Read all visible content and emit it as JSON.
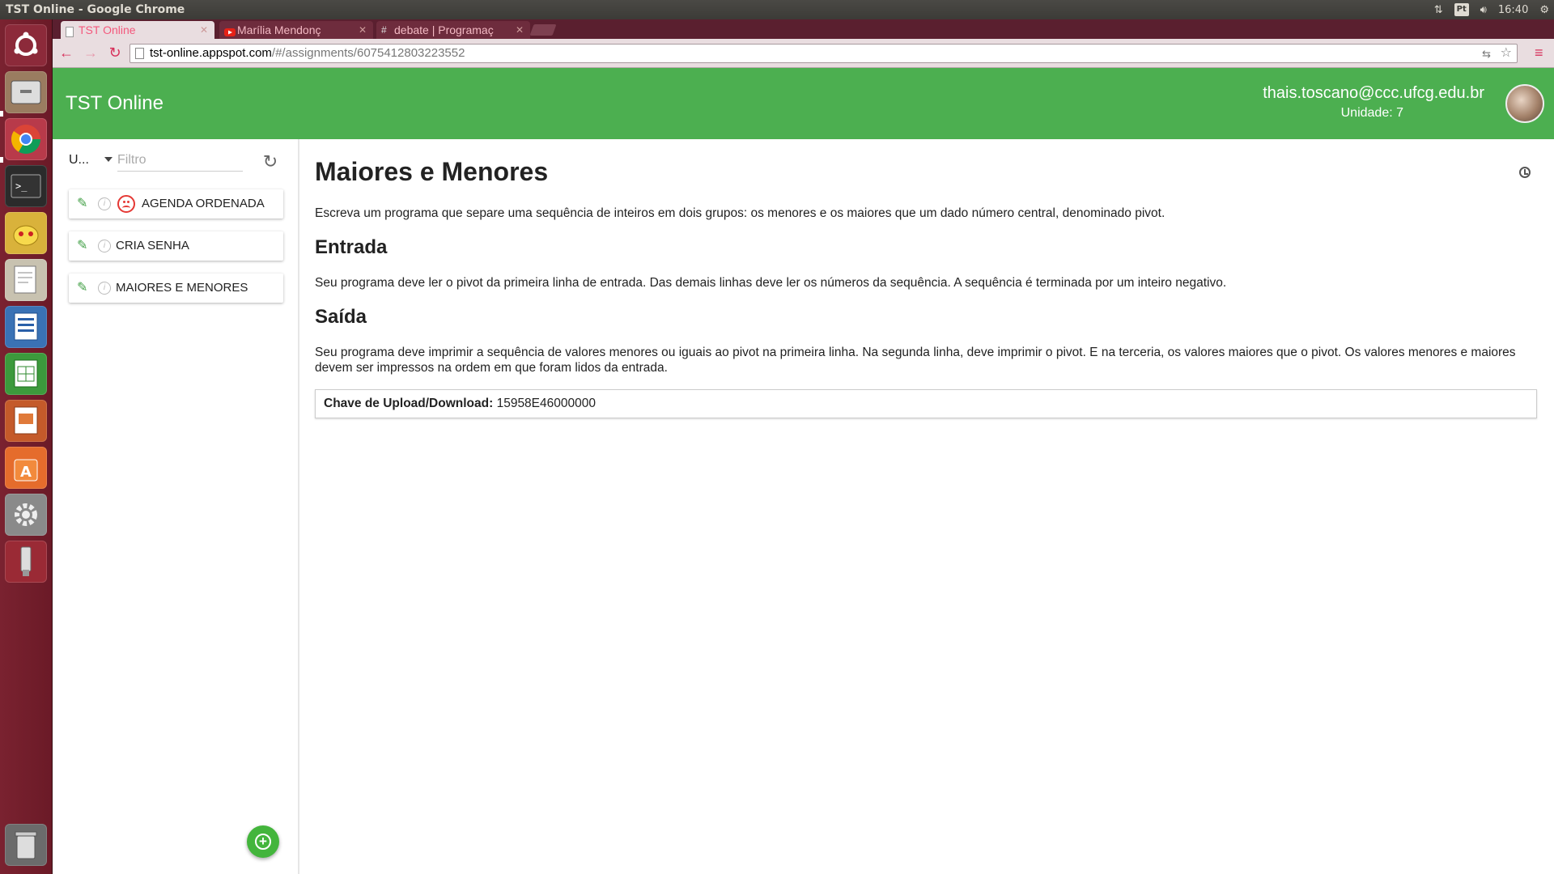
{
  "panel": {
    "window_title": "TST Online - Google Chrome",
    "keyboard_layout": "Pt",
    "clock": "16:40"
  },
  "browser": {
    "tabs": [
      {
        "title": "TST Online",
        "active": true
      },
      {
        "title": "Marília Mendonç",
        "active": false
      },
      {
        "title": "debate | Programaç",
        "active": false
      }
    ],
    "url_host": "tst-online.appspot.com",
    "url_path": "/#/assignments/6075412803223552"
  },
  "header": {
    "title": "TST Online",
    "email": "thais.toscano@ccc.ufcg.edu.br",
    "unit": "Unidade: 7",
    "accent": "#4caf50"
  },
  "sidebar": {
    "unit_select": "U...",
    "filter_placeholder": "Filtro",
    "items": [
      {
        "label": "AGENDA ORDENADA",
        "status": "failed"
      },
      {
        "label": "CRIA SENHA",
        "status": "none"
      },
      {
        "label": "MAIORES E MENORES",
        "status": "none"
      }
    ]
  },
  "content": {
    "title": "Maiores e Menores",
    "description": "Escreva um programa que separe uma sequência de inteiros em dois grupos: os menores e os maiores que um dado número central, denominado pivot.",
    "input_heading": "Entrada",
    "input_text": "Seu programa deve ler o pivot da primeira linha de entrada. Das demais linhas deve ler os números da sequência. A sequência é terminada por um inteiro negativo.",
    "output_heading": "Saída",
    "output_text": "Seu programa deve imprimir a sequência de valores menores ou iguais ao pivot na primeira linha. Na segunda linha, deve imprimir o pivot. E na terceria, os valores maiores que o pivot. Os valores menores e maiores devem ser impressos na ordem em que foram lidos da entrada.",
    "key_label": "Chave de Upload/Download:",
    "key_value": "15958E46000000"
  }
}
